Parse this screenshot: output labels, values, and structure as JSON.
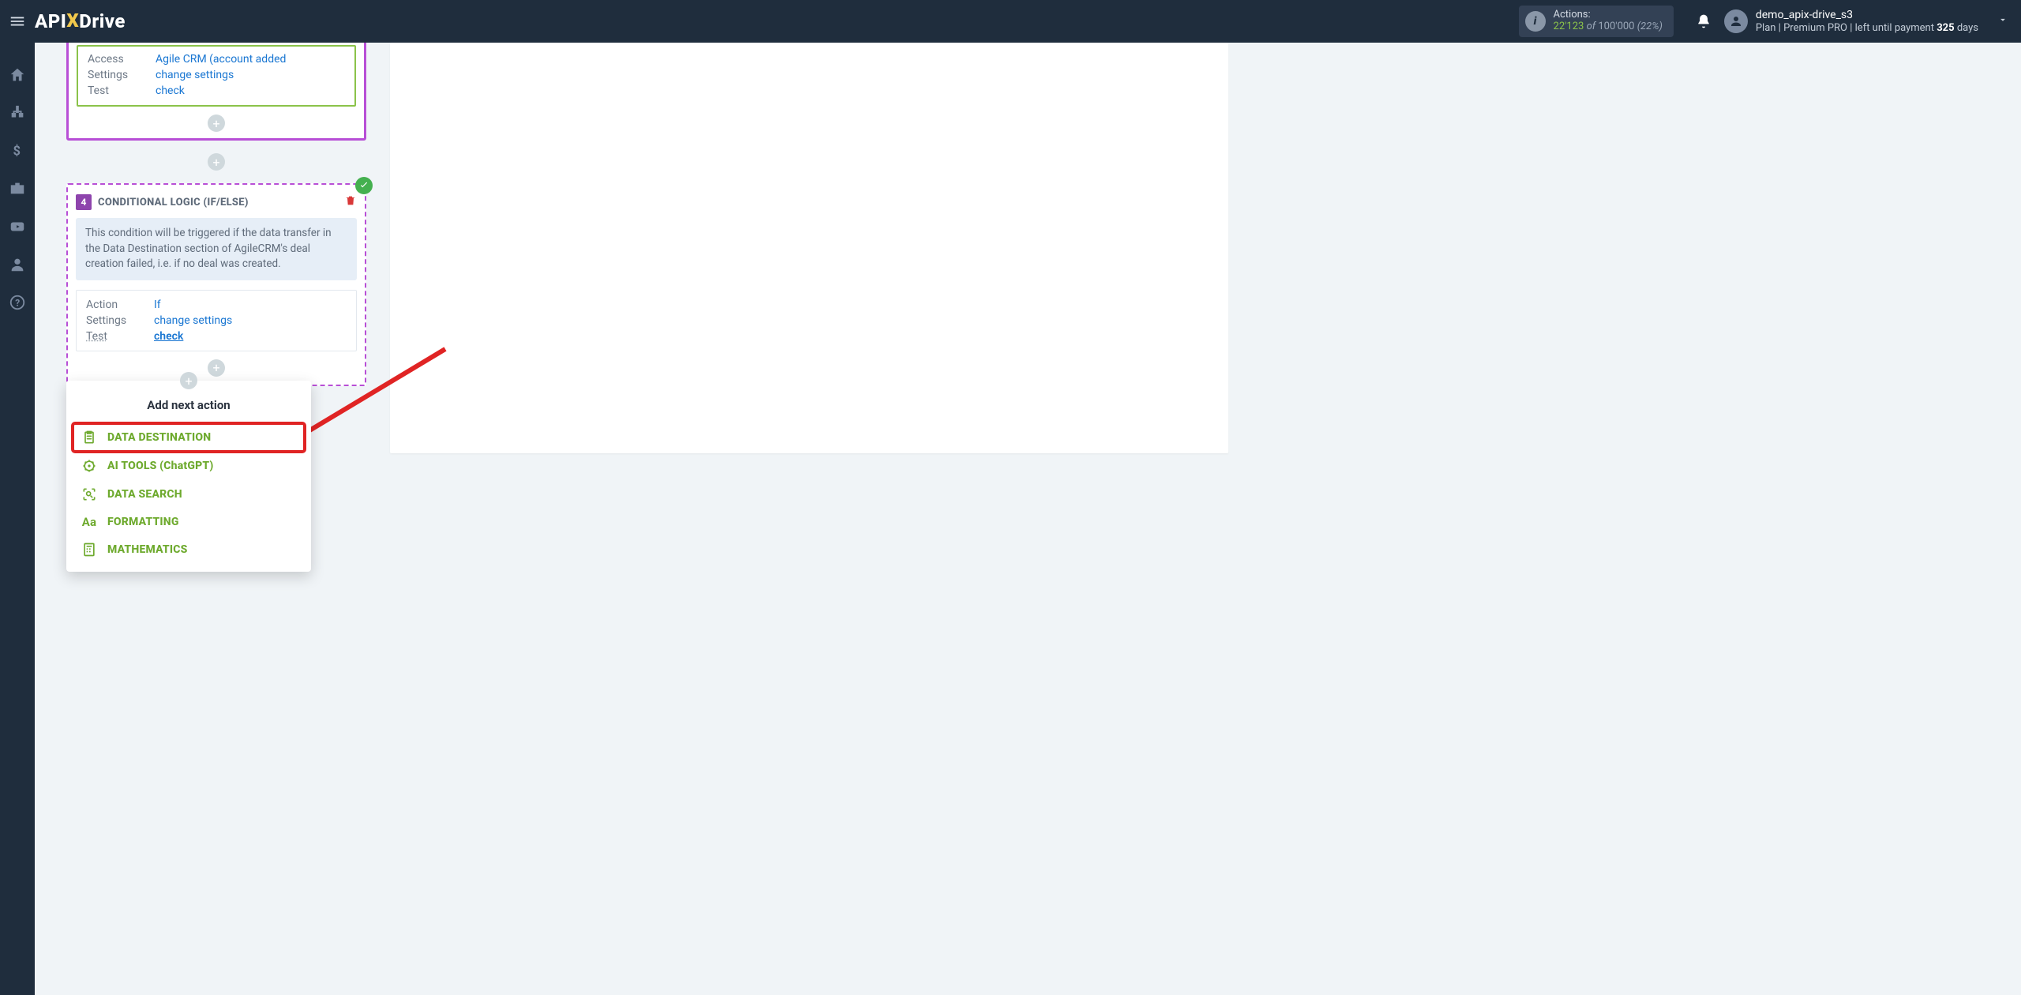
{
  "brand": {
    "pre": "API",
    "x": "X",
    "post": "Drive"
  },
  "header": {
    "actions_label": "Actions:",
    "actions_used": "22'123",
    "actions_of": "of",
    "actions_total": "100'000",
    "actions_pct": "(22%)",
    "user_name": "demo_apix-drive_s3",
    "plan_prefix": "Plan |",
    "plan_name": "Premium PRO",
    "plan_mid": "| left until payment",
    "plan_days": "325",
    "plan_suffix": "days"
  },
  "source_card": {
    "rows": [
      {
        "k": "Access",
        "v": "Agile CRM (account added"
      },
      {
        "k": "Settings",
        "v": "change settings"
      },
      {
        "k": "Test",
        "v": "check"
      }
    ]
  },
  "cond_card": {
    "num": "4",
    "title": "CONDITIONAL LOGIC (IF/ELSE)",
    "desc": "This condition will be triggered if the data transfer in the Data Destination section of AgileCRM's deal creation failed, i.e. if no deal was created.",
    "rows": {
      "action_k": "Action",
      "action_v": "If",
      "settings_k": "Settings",
      "settings_v": "change settings",
      "test_k": "Test",
      "test_v": "check"
    }
  },
  "popover": {
    "title": "Add next action",
    "items": [
      {
        "id": "data-destination",
        "label": "DATA DESTINATION",
        "highlight": true,
        "icon": "clipboard"
      },
      {
        "id": "ai-tools",
        "label": "AI TOOLS (ChatGPT)",
        "icon": "gear-head"
      },
      {
        "id": "data-search",
        "label": "DATA SEARCH",
        "icon": "scan"
      },
      {
        "id": "formatting",
        "label": "FORMATTING",
        "icon": "aa"
      },
      {
        "id": "mathematics",
        "label": "MATHEMATICS",
        "icon": "calc"
      }
    ]
  },
  "plus_glyph": "+"
}
